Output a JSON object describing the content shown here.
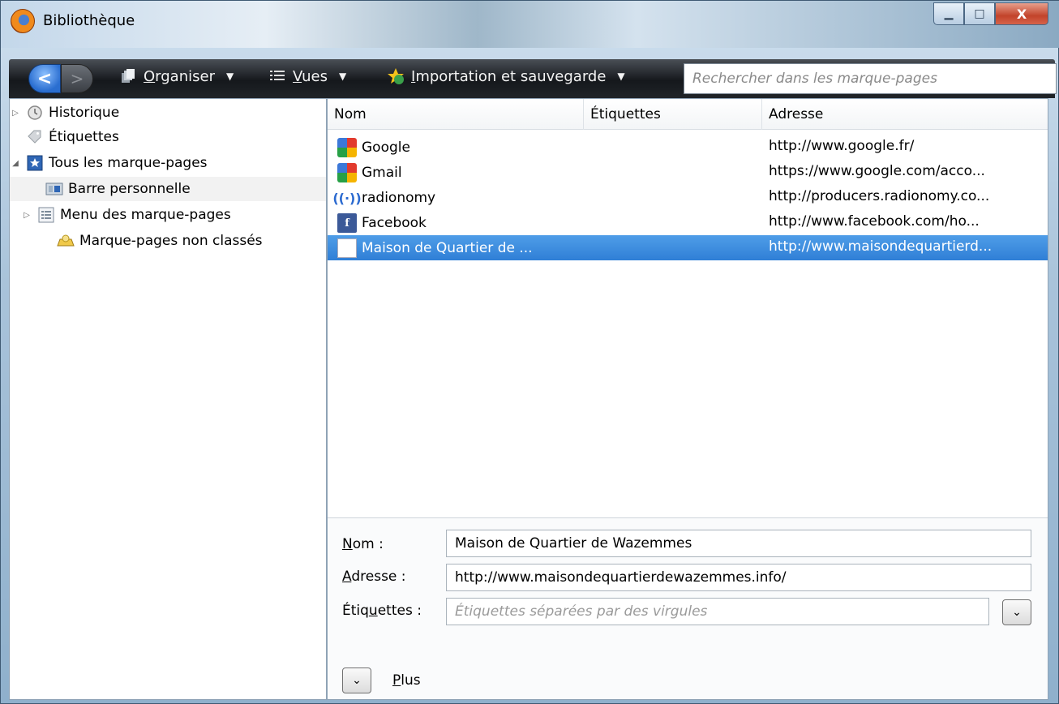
{
  "window": {
    "title": "Bibliothèque",
    "min_glyph": "▁",
    "max_glyph": "□",
    "close_glyph": "X"
  },
  "toolbar": {
    "back_glyph": "<",
    "forward_glyph": ">",
    "organiser": {
      "first": "O",
      "rest": "rganiser"
    },
    "vues": {
      "first": "V",
      "rest": "ues"
    },
    "import": {
      "first": "I",
      "rest": "mportation et sauvegarde"
    },
    "caret": "▼",
    "search_placeholder": "Rechercher dans les marque-pages"
  },
  "sidebar": {
    "items": [
      {
        "label": "Historique",
        "twisty": "▷",
        "icon": "clock-icon"
      },
      {
        "label": "Étiquettes",
        "twisty": "",
        "icon": "tag-icon"
      },
      {
        "label": "Tous les marque-pages",
        "twisty": "◢",
        "icon": "star-folder-icon"
      },
      {
        "label": "Barre personnelle",
        "twisty": "",
        "icon": "toolbar-folder-icon"
      },
      {
        "label": "Menu des marque-pages",
        "twisty": "▷",
        "icon": "menu-folder-icon"
      },
      {
        "label": "Marque-pages non classés",
        "twisty": "",
        "icon": "unsorted-folder-icon"
      }
    ]
  },
  "list": {
    "columns": [
      "Nom",
      "Étiquettes",
      "Adresse"
    ],
    "rows": [
      {
        "name": "Google",
        "address": "http://www.google.fr/",
        "icon": "google-favicon"
      },
      {
        "name": "Gmail",
        "address": "https://www.google.com/acco...",
        "icon": "google-favicon"
      },
      {
        "name": "radionomy",
        "address": "http://producers.radionomy.co...",
        "icon": "radionomy-favicon"
      },
      {
        "name": "Facebook",
        "address": "http://www.facebook.com/ho...",
        "icon": "facebook-favicon"
      },
      {
        "name": "Maison de Quartier de ...",
        "address": "http://www.maisondequartierd...",
        "icon": "page-favicon",
        "selected": true
      }
    ]
  },
  "details": {
    "nom_label": {
      "first": "N",
      "rest": "om :"
    },
    "nom_value": "Maison de Quartier de Wazemmes",
    "adresse_label": {
      "first": "A",
      "rest": "dresse :"
    },
    "adresse_value": "http://www.maisondequartierdewazemmes.info/",
    "etiquettes_label": {
      "pre": "Étiq",
      "u": "u",
      "post": "ettes :"
    },
    "etiquettes_placeholder": "Étiquettes séparées par des virgules",
    "dropdown_glyph": "⌄",
    "plus_label": {
      "first": "P",
      "rest": "lus"
    }
  }
}
